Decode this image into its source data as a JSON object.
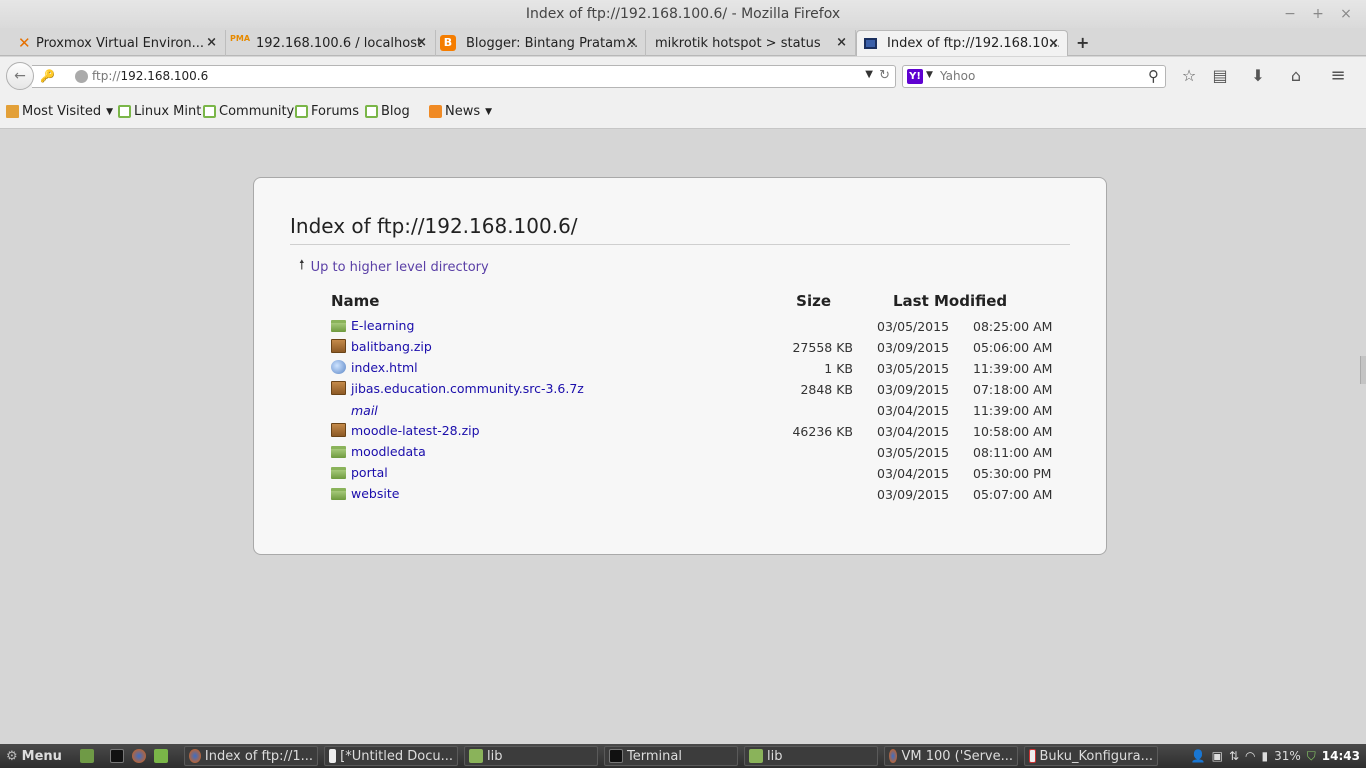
{
  "window": {
    "title": "Index of ftp://192.168.100.6/ - Mozilla Firefox",
    "controls": [
      "−",
      "+",
      "×"
    ]
  },
  "tabs": [
    {
      "label": "Proxmox Virtual Environ...",
      "icon": "proxmox-icon",
      "active": false
    },
    {
      "label": "192.168.100.6 / localhost ...",
      "icon": "phpmyadmin-icon",
      "active": false
    },
    {
      "label": "Blogger: Bintang Pratam...",
      "icon": "blogger-icon",
      "active": false
    },
    {
      "label": "mikrotik hotspot > status",
      "icon": "",
      "active": false
    },
    {
      "label": "Index of ftp://192.168.10...",
      "icon": "ftp-icon",
      "active": true
    }
  ],
  "tab_close": "×",
  "new_tab": "+",
  "navbar": {
    "url_proto": "ftp://",
    "url_host": "192.168.100.6",
    "search_placeholder": "Yahoo",
    "search_engine_icon": "Y!"
  },
  "bookmarks": [
    {
      "label": "Most Visited",
      "icon": "folder-icon",
      "dropdown": true
    },
    {
      "label": "Linux Mint",
      "icon": "mint-icon",
      "dropdown": false
    },
    {
      "label": "Community",
      "icon": "mint-icon",
      "dropdown": false
    },
    {
      "label": "Forums",
      "icon": "mint-icon",
      "dropdown": false
    },
    {
      "label": "Blog",
      "icon": "mint-icon",
      "dropdown": false
    },
    {
      "label": "News",
      "icon": "rss-icon",
      "dropdown": true
    }
  ],
  "listing": {
    "title": "Index of ftp://192.168.100.6/",
    "up_link": "Up to higher level directory",
    "headers": {
      "name": "Name",
      "size": "Size",
      "modified": "Last Modified"
    },
    "rows": [
      {
        "name": "E-learning",
        "type": "folder",
        "size": "",
        "date": "03/05/2015",
        "time": "08:25:00 AM"
      },
      {
        "name": "balitbang.zip",
        "type": "zip",
        "size": "27558 KB",
        "date": "03/09/2015",
        "time": "05:06:00 AM"
      },
      {
        "name": "index.html",
        "type": "html",
        "size": "1 KB",
        "date": "03/05/2015",
        "time": "11:39:00 AM"
      },
      {
        "name": "jibas.education.community.src-3.6.7z",
        "type": "zip",
        "size": "2848 KB",
        "date": "03/09/2015",
        "time": "07:18:00 AM"
      },
      {
        "name": "mail",
        "type": "symlink",
        "size": "",
        "date": "03/04/2015",
        "time": "11:39:00 AM"
      },
      {
        "name": "moodle-latest-28.zip",
        "type": "zip",
        "size": "46236 KB",
        "date": "03/04/2015",
        "time": "10:58:00 AM"
      },
      {
        "name": "moodledata",
        "type": "folder",
        "size": "",
        "date": "03/05/2015",
        "time": "08:11:00 AM"
      },
      {
        "name": "portal",
        "type": "folder",
        "size": "",
        "date": "03/04/2015",
        "time": "05:30:00 PM"
      },
      {
        "name": "website",
        "type": "folder",
        "size": "",
        "date": "03/09/2015",
        "time": "05:07:00 AM"
      }
    ]
  },
  "taskbar": {
    "menu_label": "Menu",
    "windows": [
      "Index of ftp://1...",
      "[*Untitled Docu...",
      "lib",
      "Terminal",
      "lib",
      "VM 100 ('Serve...",
      "Buku_Konfigura..."
    ],
    "battery": "31%",
    "clock": "14:43"
  }
}
